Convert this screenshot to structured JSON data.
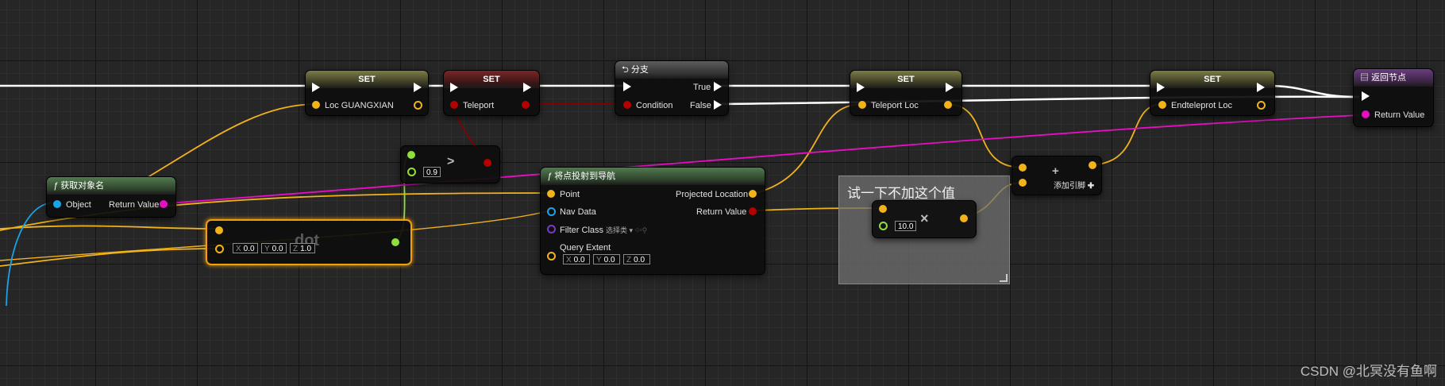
{
  "nodes": {
    "set_loc": {
      "header": "SET",
      "label": "Loc GUANGXIAN"
    },
    "set_teleport": {
      "header": "SET",
      "label": "Teleport"
    },
    "branch": {
      "header": "分支",
      "true_label": "True",
      "condition_label": "Condition",
      "false_label": "False"
    },
    "set_teleport_loc": {
      "header": "SET",
      "label": "Teleport Loc"
    },
    "set_endteleport": {
      "header": "SET",
      "label": "Endteleprot Loc"
    },
    "return_node": {
      "header": "返回节点",
      "return_value_label": "Return Value"
    },
    "get_object_name": {
      "header": "获取对象名",
      "object_label": "Object",
      "return_value_label": "Return Value"
    },
    "greater": {
      "operator": ">",
      "value": "0.9"
    },
    "dot": {
      "title": "dot",
      "x": "0.0",
      "y": "0.0",
      "z": "1.0"
    },
    "project_nav": {
      "header": "将点投射到导航",
      "point_label": "Point",
      "nav_data_label": "Nav Data",
      "filter_class_label": "Filter Class",
      "filter_class_value": "选择类",
      "query_extent_label": "Query Extent",
      "x": "0.0",
      "y": "0.0",
      "z": "0.0",
      "projected_location_label": "Projected Location",
      "return_value_label": "Return Value"
    },
    "multiply": {
      "operator": "×",
      "value": "10.0"
    },
    "add": {
      "operator": "+",
      "add_pin_label": "添加引脚"
    }
  },
  "comment": {
    "text": "试一下不加这个值"
  },
  "axis_labels": {
    "x": "X",
    "y": "Y",
    "z": "Z"
  },
  "watermark": "CSDN @北冥没有鱼啊",
  "colors": {
    "exec": "#ffffff",
    "vector": "#f1b21a",
    "object": "#1aa3e8",
    "bool": "#b30000",
    "string": "#e60fc2",
    "float": "#8fe03a",
    "class": "#7a38c8"
  }
}
